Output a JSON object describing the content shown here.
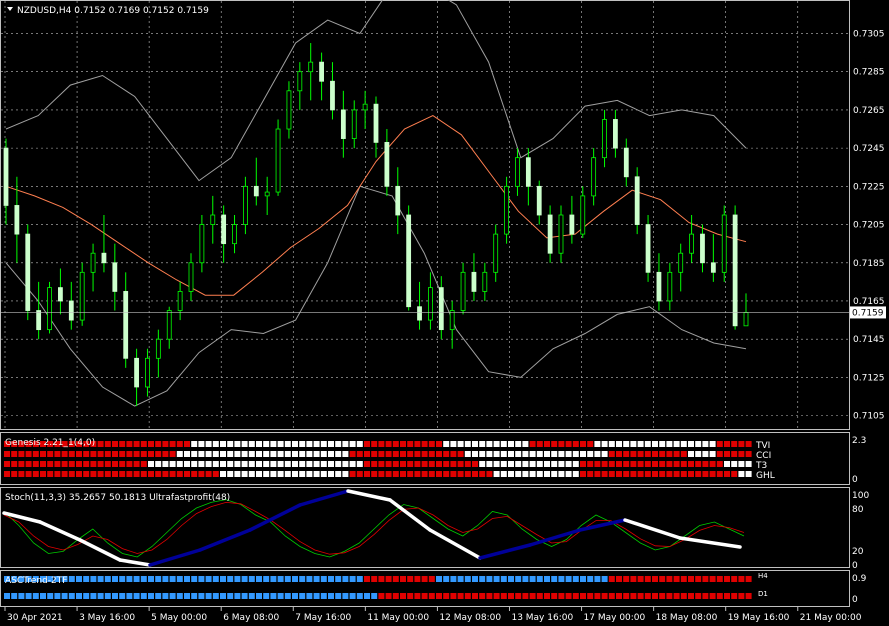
{
  "main": {
    "header": "NZDUSD,H4  0.7152 0.7169 0.7152 0.7159",
    "price_ticks": [
      "0.7305",
      "0.7285",
      "0.7265",
      "0.7245",
      "0.7225",
      "0.7205",
      "0.7185",
      "0.7165",
      "0.7145",
      "0.7125",
      "0.7105"
    ],
    "current_price": "0.7159",
    "ylim": [
      0.7098,
      0.7322
    ]
  },
  "genesis": {
    "title": "Genesis 2.21_1(4,0)",
    "row_labels": [
      "TVI",
      "CCI",
      "T3",
      "GHL"
    ],
    "scale_top": "2.3",
    "scale_bottom": "0"
  },
  "stoch": {
    "title": "Stoch(11,3,3) 35.2657 50.1813  Ultrafastprofit(48)",
    "scale_labels": [
      "100",
      "80",
      "20",
      "0"
    ]
  },
  "asc": {
    "title": "ASCTrend-2TF",
    "row_labels": [
      "H4",
      "D1"
    ],
    "scale_top": "0.9",
    "scale_bottom": "0"
  },
  "time_axis": [
    "30 Apr 2021",
    "3 May 16:00",
    "5 May 00:00",
    "6 May 08:00",
    "7 May 16:00",
    "11 May 00:00",
    "12 May 08:00",
    "13 May 16:00",
    "17 May 00:00",
    "18 May 08:00",
    "19 May 16:00",
    "21 May 00:00"
  ],
  "colors": {
    "background": "#000000",
    "grid": "#c0c0c0",
    "bull_candle": "#ccffcc",
    "wick": "#00ff00",
    "ma": "#ff7f50",
    "bands": "#a0a0a0",
    "red": "#e00000",
    "white": "#ffffff",
    "blue": "#3399ff",
    "navy": "#000099"
  },
  "chart_data": {
    "type": "candlestick",
    "series": [
      {
        "name": "NZDUSD,H4",
        "values": [
          [
            0.7245,
            0.725,
            0.7205,
            0.7215
          ],
          [
            0.7215,
            0.723,
            0.7185,
            0.72
          ],
          [
            0.72,
            0.7205,
            0.7155,
            0.716
          ],
          [
            0.716,
            0.7175,
            0.7145,
            0.715
          ],
          [
            0.715,
            0.7175,
            0.7148,
            0.7172
          ],
          [
            0.7172,
            0.7182,
            0.7158,
            0.7165
          ],
          [
            0.7165,
            0.7175,
            0.715,
            0.7155
          ],
          [
            0.7155,
            0.7185,
            0.7152,
            0.718
          ],
          [
            0.718,
            0.7195,
            0.717,
            0.719
          ],
          [
            0.719,
            0.721,
            0.718,
            0.7185
          ],
          [
            0.7185,
            0.7195,
            0.716,
            0.717
          ],
          [
            0.717,
            0.718,
            0.713,
            0.7135
          ],
          [
            0.7135,
            0.714,
            0.711,
            0.712
          ],
          [
            0.712,
            0.714,
            0.7115,
            0.7135
          ],
          [
            0.7135,
            0.715,
            0.7125,
            0.7145
          ],
          [
            0.7145,
            0.7162,
            0.714,
            0.716
          ],
          [
            0.716,
            0.7175,
            0.7155,
            0.717
          ],
          [
            0.717,
            0.719,
            0.7165,
            0.7185
          ],
          [
            0.7185,
            0.721,
            0.718,
            0.7205
          ],
          [
            0.7205,
            0.722,
            0.7195,
            0.721
          ],
          [
            0.721,
            0.7215,
            0.7185,
            0.7195
          ],
          [
            0.7195,
            0.721,
            0.719,
            0.7205
          ],
          [
            0.7205,
            0.723,
            0.72,
            0.7225
          ],
          [
            0.7225,
            0.724,
            0.7215,
            0.722
          ],
          [
            0.722,
            0.723,
            0.721,
            0.7222
          ],
          [
            0.7222,
            0.726,
            0.722,
            0.7255
          ],
          [
            0.7255,
            0.728,
            0.725,
            0.7275
          ],
          [
            0.7275,
            0.729,
            0.7265,
            0.7285
          ],
          [
            0.7285,
            0.73,
            0.727,
            0.729
          ],
          [
            0.729,
            0.7295,
            0.727,
            0.728
          ],
          [
            0.728,
            0.729,
            0.726,
            0.7265
          ],
          [
            0.7265,
            0.7275,
            0.724,
            0.725
          ],
          [
            0.725,
            0.727,
            0.7245,
            0.7265
          ],
          [
            0.7265,
            0.7275,
            0.7255,
            0.7268
          ],
          [
            0.7268,
            0.7272,
            0.724,
            0.7248
          ],
          [
            0.7248,
            0.7255,
            0.722,
            0.7225
          ],
          [
            0.7225,
            0.7235,
            0.72,
            0.721
          ],
          [
            0.721,
            0.7215,
            0.716,
            0.7162
          ],
          [
            0.7162,
            0.7175,
            0.715,
            0.7155
          ],
          [
            0.7155,
            0.718,
            0.715,
            0.7172
          ],
          [
            0.7172,
            0.7178,
            0.7145,
            0.715
          ],
          [
            0.715,
            0.7165,
            0.714,
            0.716
          ],
          [
            0.716,
            0.7185,
            0.7158,
            0.718
          ],
          [
            0.718,
            0.719,
            0.7165,
            0.717
          ],
          [
            0.717,
            0.7185,
            0.7165,
            0.718
          ],
          [
            0.718,
            0.7205,
            0.7175,
            0.72
          ],
          [
            0.72,
            0.723,
            0.7195,
            0.7225
          ],
          [
            0.7225,
            0.7245,
            0.722,
            0.724
          ],
          [
            0.724,
            0.7245,
            0.7215,
            0.7225
          ],
          [
            0.7225,
            0.7228,
            0.7205,
            0.721
          ],
          [
            0.721,
            0.7215,
            0.7185,
            0.719
          ],
          [
            0.719,
            0.7215,
            0.7185,
            0.721
          ],
          [
            0.721,
            0.722,
            0.7195,
            0.72
          ],
          [
            0.72,
            0.7225,
            0.7198,
            0.722
          ],
          [
            0.722,
            0.7245,
            0.7215,
            0.724
          ],
          [
            0.724,
            0.7265,
            0.7235,
            0.726
          ],
          [
            0.726,
            0.7265,
            0.724,
            0.7245
          ],
          [
            0.7245,
            0.725,
            0.7225,
            0.723
          ],
          [
            0.723,
            0.7235,
            0.72,
            0.7205
          ],
          [
            0.7205,
            0.721,
            0.7175,
            0.718
          ],
          [
            0.718,
            0.719,
            0.716,
            0.7165
          ],
          [
            0.7165,
            0.7185,
            0.716,
            0.718
          ],
          [
            0.718,
            0.7195,
            0.717,
            0.719
          ],
          [
            0.719,
            0.721,
            0.7185,
            0.72
          ],
          [
            0.72,
            0.7205,
            0.718,
            0.7185
          ],
          [
            0.7185,
            0.72,
            0.7175,
            0.718
          ],
          [
            0.718,
            0.7215,
            0.7175,
            0.721
          ],
          [
            0.721,
            0.7215,
            0.715,
            0.7152
          ],
          [
            0.7152,
            0.7169,
            0.7152,
            0.7159
          ]
        ]
      }
    ],
    "ma_values": [
      0.7225,
      0.722,
      0.7214,
      0.7205,
      0.7195,
      0.7185,
      0.7176,
      0.7168,
      0.7168,
      0.718,
      0.7193,
      0.7203,
      0.7215,
      0.7238,
      0.7255,
      0.7262,
      0.7252,
      0.7232,
      0.7212,
      0.7198,
      0.72,
      0.7212,
      0.7223,
      0.7218,
      0.7206,
      0.72,
      0.7196
    ],
    "upper_band": [
      0.7255,
      0.7262,
      0.7278,
      0.7283,
      0.7272,
      0.725,
      0.7228,
      0.724,
      0.727,
      0.73,
      0.7312,
      0.7305,
      0.733,
      0.733,
      0.732,
      0.729,
      0.724,
      0.725,
      0.7267,
      0.727,
      0.7262,
      0.7265,
      0.7262,
      0.7245
    ],
    "lower_band": [
      0.7185,
      0.7165,
      0.714,
      0.712,
      0.711,
      0.7118,
      0.7138,
      0.715,
      0.7148,
      0.7155,
      0.7185,
      0.7225,
      0.722,
      0.719,
      0.715,
      0.7128,
      0.7125,
      0.714,
      0.7148,
      0.7158,
      0.7162,
      0.715,
      0.7143,
      0.714
    ]
  }
}
